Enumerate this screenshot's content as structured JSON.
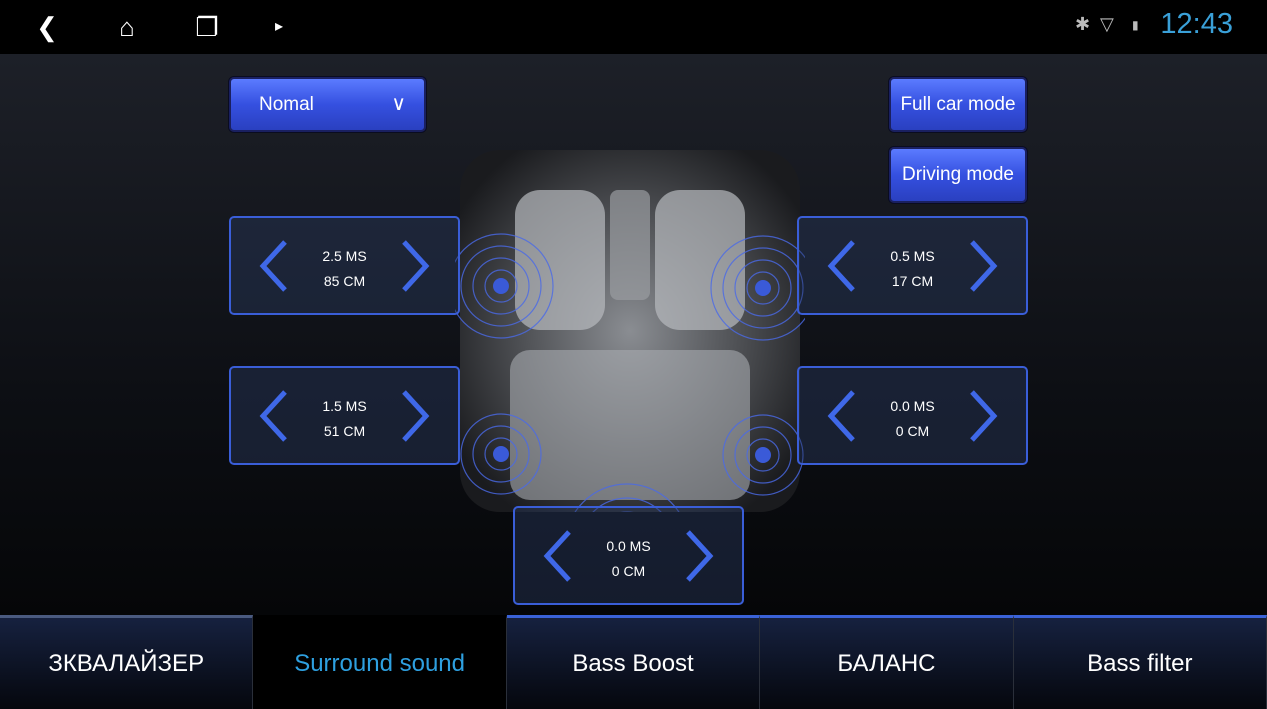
{
  "status_bar": {
    "time": "12:43",
    "icons": [
      "back-icon",
      "home-icon",
      "recent-apps-icon",
      "app-icon",
      "bluetooth-icon",
      "wifi-icon",
      "sim-icon"
    ]
  },
  "preset_dropdown": {
    "value": "Nomal"
  },
  "mode_buttons": {
    "full_car": "Full car mode",
    "driving": "Driving mode"
  },
  "speakers": [
    {
      "position": "front-left",
      "delay": "2.5 MS",
      "distance": "85 CM"
    },
    {
      "position": "front-right",
      "delay": "0.5 MS",
      "distance": "17 CM"
    },
    {
      "position": "rear-left",
      "delay": "1.5 MS",
      "distance": "51 CM"
    },
    {
      "position": "rear-right",
      "delay": "0.0 MS",
      "distance": "0 CM"
    },
    {
      "position": "subwoofer",
      "delay": "0.0 MS",
      "distance": "0 CM"
    }
  ],
  "tabs": [
    {
      "label": "ЗКВАЛАЙЗЕР",
      "active": false
    },
    {
      "label": "Surround sound",
      "active": true
    },
    {
      "label": "Bass Boost",
      "active": false
    },
    {
      "label": "БАЛАНС",
      "active": false
    },
    {
      "label": "Bass filter",
      "active": false
    }
  ],
  "colors": {
    "accent": "#3a5ed8",
    "active_tab": "#2ea0e0",
    "clock": "#3aa0d8"
  }
}
